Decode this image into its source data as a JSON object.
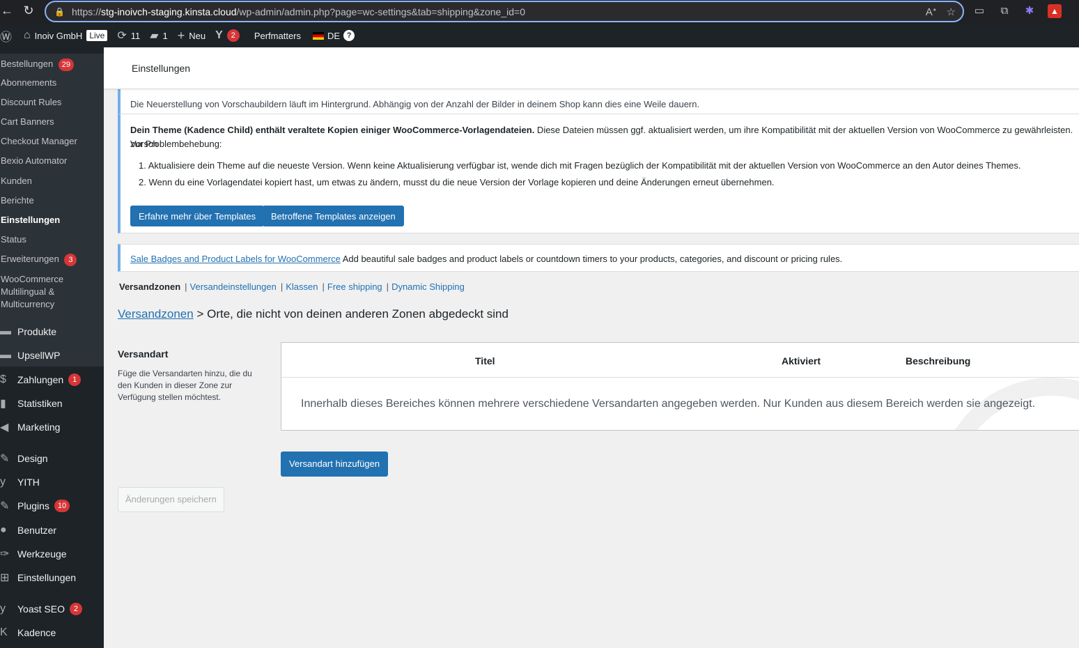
{
  "browser": {
    "url_scheme": "https://",
    "url_host": "stg-inoivch-staging.kinsta.cloud",
    "url_path": "/wp-admin/admin.php?page=wc-settings&tab=shipping&zone_id=0"
  },
  "adminbar": {
    "site_name": "Inoiv GmbH",
    "live_label": "Live",
    "updates_count": "11",
    "comments_count": "1",
    "new_label": "Neu",
    "yoast_count": "2",
    "perfmatters_label": "Perfmatters",
    "language_label": "DE",
    "help_label": "?"
  },
  "sidebar": {
    "submenu": [
      {
        "label": "Bestellungen",
        "badge": "29"
      },
      {
        "label": "Abonnements",
        "badge": ""
      },
      {
        "label": "Discount Rules",
        "badge": ""
      },
      {
        "label": "Cart Banners",
        "badge": ""
      },
      {
        "label": "Checkout Manager",
        "badge": ""
      },
      {
        "label": "Bexio Automator",
        "badge": ""
      },
      {
        "label": "Kunden",
        "badge": ""
      },
      {
        "label": "Berichte",
        "badge": ""
      },
      {
        "label": "Einstellungen",
        "badge": ""
      },
      {
        "label": "Status",
        "badge": ""
      },
      {
        "label": "Erweiterungen",
        "badge": "3"
      },
      {
        "label": "WooCommerce Multilingual & Multicurrency",
        "badge": ""
      }
    ],
    "menu": [
      {
        "label": "Produkte",
        "icon": "archive-icon",
        "badge": ""
      },
      {
        "label": "UpsellWP",
        "icon": "upsell-icon",
        "badge": ""
      },
      {
        "label": "Zahlungen",
        "icon": "dollar-icon",
        "badge": "1"
      },
      {
        "label": "Statistiken",
        "icon": "bar-chart-icon",
        "badge": ""
      },
      {
        "label": "Marketing",
        "icon": "megaphone-icon",
        "badge": ""
      },
      {
        "label": "Design",
        "icon": "brush-icon",
        "badge": ""
      },
      {
        "label": "YITH",
        "icon": "yith-icon",
        "badge": ""
      },
      {
        "label": "Plugins",
        "icon": "plug-icon",
        "badge": "10"
      },
      {
        "label": "Benutzer",
        "icon": "user-icon",
        "badge": ""
      },
      {
        "label": "Werkzeuge",
        "icon": "wrench-icon",
        "badge": ""
      },
      {
        "label": "Einstellungen",
        "icon": "sliders-icon",
        "badge": ""
      },
      {
        "label": "Yoast SEO",
        "icon": "yoast-icon",
        "badge": "2"
      },
      {
        "label": "Kadence",
        "icon": "kadence-icon",
        "badge": ""
      }
    ]
  },
  "header": {
    "title": "Einstellungen"
  },
  "notices": {
    "thumbnail_text": "Die Neuerstellung von Vorschaubildern läuft im Hintergrund. Abhängig von der Anzahl der Bilder in deinem Shop kann dies eine Weile dauern.",
    "theme_bold": "Dein Theme (Kadence Child) enthält veraltete Kopien einiger WooCommerce-Vorlagendateien.",
    "theme_rest": " Diese Dateien müssen ggf. aktualisiert werden, um ihre Kompatibilität mit der aktuellen Version von WooCommerce zu gewährleisten. Vorsch",
    "theme_line2": "zur Problembehebung:",
    "theme_step1": "1. Aktualisiere dein Theme auf die neueste Version. Wenn keine Aktualisierung verfügbar ist, wende dich mit Fragen bezüglich der Kompatibilität mit der aktuellen Version von WooCommerce an den Autor deines Themes.",
    "theme_step2": "2. Wenn du eine Vorlagendatei kopiert hast, um etwas zu ändern, musst du die neue Version der Vorlage kopieren und deine Änderungen erneut übernehmen.",
    "btn_learn": "Erfahre mehr über Templates",
    "btn_affected": "Betroffene Templates anzeigen",
    "sale_link": "Sale Badges and Product Labels for WooCommerce",
    "sale_text": " Add beautiful sale badges and product labels or countdown timers to your products, categories, and discount or pricing rules."
  },
  "subnav": {
    "current": "Versandzonen",
    "links": [
      "Versandeinstellungen",
      "Klassen",
      "Free shipping",
      "Dynamic Shipping"
    ]
  },
  "zone": {
    "breadcrumb_link": "Versandzonen",
    "separator": ">",
    "title": "Orte, die nicht von deinen anderen Zonen abgedeckt sind"
  },
  "methods": {
    "section_title": "Versandart",
    "section_desc": "Füge die Versandarten hinzu, die du den Kunden in dieser Zone zur Verfügung stellen möchtest.",
    "col_title": "Titel",
    "col_enabled": "Aktiviert",
    "col_description": "Beschreibung",
    "empty_text": "Innerhalb dieses Bereiches können mehrere verschiedene Versandarten angegeben werden. Nur Kunden aus diesem Bereich werden sie angezeigt.",
    "add_button": "Versandart hinzufügen",
    "save_button": "Änderungen speichern"
  },
  "colors": {
    "accent": "#2271b1",
    "admin_bg": "#1d2327",
    "badge_red": "#d63638",
    "notice_border": "#72aee6"
  }
}
